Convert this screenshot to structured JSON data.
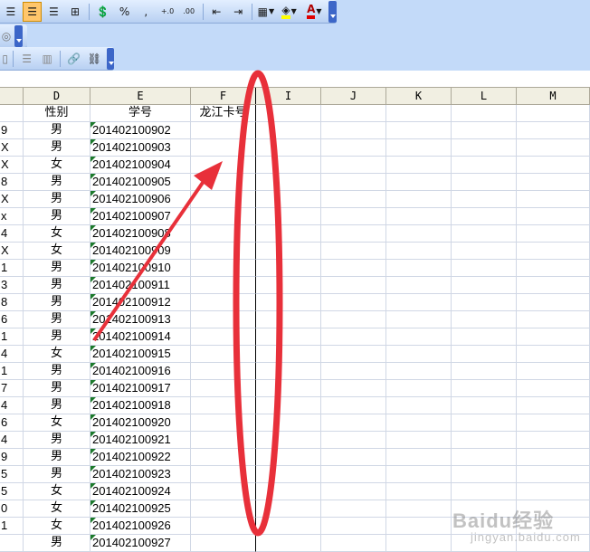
{
  "toolbar": {
    "percent": "%",
    "comma": ",",
    "inc_decimal": "+.0\n.00",
    "dec_decimal": ".00\n→.0",
    "font_color_letter": "A"
  },
  "columns": [
    "D",
    "E",
    "F",
    "I",
    "J",
    "K",
    "L",
    "M"
  ],
  "header_row": {
    "gender": "性别",
    "student_id": "学号",
    "card": "龙江卡号"
  },
  "rows": [
    {
      "a": "9",
      "gender": "男",
      "id": "201402100902"
    },
    {
      "a": "X",
      "gender": "男",
      "id": "201402100903"
    },
    {
      "a": "X",
      "gender": "女",
      "id": "201402100904"
    },
    {
      "a": "8",
      "gender": "男",
      "id": "201402100905"
    },
    {
      "a": "X",
      "gender": "男",
      "id": "201402100906"
    },
    {
      "a": "x",
      "gender": "男",
      "id": "201402100907"
    },
    {
      "a": "4",
      "gender": "女",
      "id": "201402100908"
    },
    {
      "a": "X",
      "gender": "女",
      "id": "201402100909"
    },
    {
      "a": "1",
      "gender": "男",
      "id": "201402100910"
    },
    {
      "a": "3",
      "gender": "男",
      "id": "201402100911"
    },
    {
      "a": "8",
      "gender": "男",
      "id": "201402100912"
    },
    {
      "a": "6",
      "gender": "男",
      "id": "201402100913"
    },
    {
      "a": "1",
      "gender": "男",
      "id": "201402100914"
    },
    {
      "a": "4",
      "gender": "女",
      "id": "201402100915"
    },
    {
      "a": "1",
      "gender": "男",
      "id": "201402100916"
    },
    {
      "a": "7",
      "gender": "男",
      "id": "201402100917"
    },
    {
      "a": "4",
      "gender": "男",
      "id": "201402100918"
    },
    {
      "a": "6",
      "gender": "女",
      "id": "201402100920"
    },
    {
      "a": "4",
      "gender": "男",
      "id": "201402100921"
    },
    {
      "a": "9",
      "gender": "男",
      "id": "201402100922"
    },
    {
      "a": "5",
      "gender": "男",
      "id": "201402100923"
    },
    {
      "a": "5",
      "gender": "女",
      "id": "201402100924"
    },
    {
      "a": "0",
      "gender": "女",
      "id": "201402100925"
    },
    {
      "a": "1",
      "gender": "女",
      "id": "201402100926"
    },
    {
      "a": "",
      "gender": "男",
      "id": "201402100927"
    }
  ],
  "watermark": {
    "brand": "Baidu经验",
    "sub": "jingyan.baidu.com"
  },
  "colors": {
    "annotation": "#e8303a",
    "toolbar_bg": "#c3daf9"
  }
}
